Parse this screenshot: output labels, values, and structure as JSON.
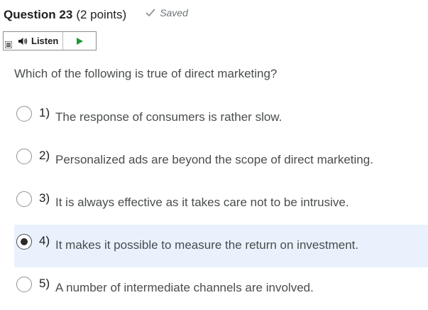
{
  "question": {
    "number_label": "Question 23",
    "points_label": "(2 points)",
    "status_label": "Saved",
    "status_icon": "checkmark-icon",
    "text": "Which of the following is true of direct marketing?"
  },
  "listen_toolbar": {
    "menu_icon": "menu-icon",
    "speaker_icon": "speaker-icon",
    "listen_label": "Listen",
    "play_icon": "play-icon",
    "play_color": "#1c9a3a"
  },
  "options": [
    {
      "number": "1)",
      "text": "The response of consumers is rather slow.",
      "selected": false
    },
    {
      "number": "2)",
      "text": "Personalized ads are beyond the scope of direct marketing.",
      "selected": false
    },
    {
      "number": "3)",
      "text": "It is always effective as it takes care not to be intrusive.",
      "selected": false
    },
    {
      "number": "4)",
      "text": "It makes it possible to measure the return on investment.",
      "selected": true
    },
    {
      "number": "5)",
      "text": "A number of intermediate channels are involved.",
      "selected": false
    }
  ],
  "colors": {
    "selected_background": "#e9f2fc",
    "saved_text": "#6e7376"
  }
}
